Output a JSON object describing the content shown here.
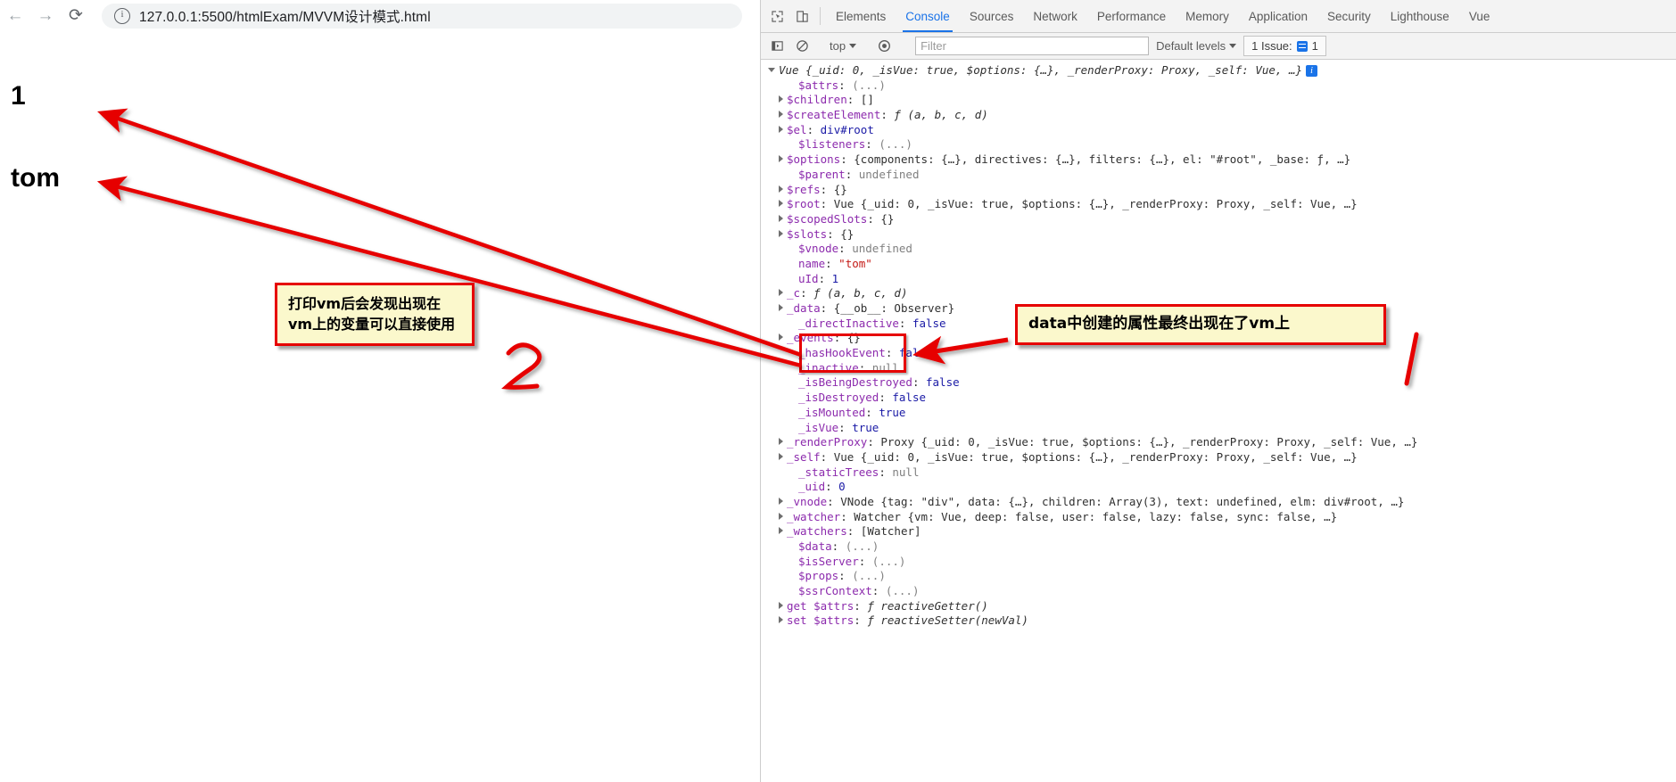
{
  "browser": {
    "back_icon": "arrow-left-icon",
    "forward_icon": "arrow-right-icon",
    "reload_icon": "reload-icon",
    "site_info_icon": "info-circle-icon",
    "url": "127.0.0.1:5500/htmlExam/MVVM设计模式.html"
  },
  "page": {
    "uid_text": "1",
    "name_text": "tom"
  },
  "annotations": {
    "left_box": "打印vm后会发现出现在vm上的变量可以直接使用",
    "right_box": "data中创建的属性最终出现在了vm上",
    "mark_two": "2",
    "mark_one": "1",
    "highlight_color": "#e60000",
    "box_fill": "#fbf8cc"
  },
  "devtools": {
    "inspect_icon": "inspect-element-icon",
    "device_icon": "device-toolbar-icon",
    "tabs": [
      {
        "label": "Elements",
        "selected": false
      },
      {
        "label": "Console",
        "selected": true
      },
      {
        "label": "Sources",
        "selected": false
      },
      {
        "label": "Network",
        "selected": false
      },
      {
        "label": "Performance",
        "selected": false
      },
      {
        "label": "Memory",
        "selected": false
      },
      {
        "label": "Application",
        "selected": false
      },
      {
        "label": "Security",
        "selected": false
      },
      {
        "label": "Lighthouse",
        "selected": false
      },
      {
        "label": "Vue",
        "selected": false
      }
    ],
    "toolbar": {
      "sidebar_icon": "console-sidebar-icon",
      "clear_icon": "clear-console-icon",
      "context": "top",
      "eye_icon": "live-expression-icon",
      "filter_value": "",
      "filter_placeholder": "Filter",
      "levels": "Default levels",
      "issues_label": "1 Issue:",
      "issues_icon": "issues-icon",
      "issues_count": "1",
      "accent_color": "#1a73e8"
    }
  },
  "console": {
    "header": {
      "type": "Vue",
      "text": "Vue {_uid: 0, _isVue: true, $options: {…}, _renderProxy: Proxy, _self: Vue, …}",
      "info_badge": "i"
    },
    "rows": [
      {
        "tri": "none",
        "key": "$attrs",
        "keyclass": "k-prop",
        "sep": ": ",
        "value": "(...)",
        "valclass": "v-dots"
      },
      {
        "tri": "closed",
        "key": "$children",
        "keyclass": "k-prop",
        "sep": ": ",
        "value": "[]",
        "valclass": "v-obj"
      },
      {
        "tri": "closed",
        "key": "$createElement",
        "keyclass": "k-prop",
        "sep": ": ",
        "value": "ƒ (a, b, c, d)",
        "valclass": "v-fn"
      },
      {
        "tri": "closed",
        "key": "$el",
        "keyclass": "k-prop",
        "sep": ": ",
        "value": "div#root",
        "valclass": "v-dom"
      },
      {
        "tri": "none",
        "key": "$listeners",
        "keyclass": "k-prop",
        "sep": ": ",
        "value": "(...)",
        "valclass": "v-dots"
      },
      {
        "tri": "closed",
        "key": "$options",
        "keyclass": "k-prop",
        "sep": ": ",
        "value": "{components: {…}, directives: {…}, filters: {…}, el: \"#root\", _base: ƒ, …}",
        "valclass": "v-obj"
      },
      {
        "tri": "none",
        "key": "$parent",
        "keyclass": "k-prop",
        "sep": ": ",
        "value": "undefined",
        "valclass": "v-undef"
      },
      {
        "tri": "closed",
        "key": "$refs",
        "keyclass": "k-prop",
        "sep": ": ",
        "value": "{}",
        "valclass": "v-obj"
      },
      {
        "tri": "closed",
        "key": "$root",
        "keyclass": "k-prop",
        "sep": ": ",
        "value": "Vue {_uid: 0, _isVue: true, $options: {…}, _renderProxy: Proxy, _self: Vue, …}",
        "valclass": "v-obj"
      },
      {
        "tri": "closed",
        "key": "$scopedSlots",
        "keyclass": "k-prop",
        "sep": ": ",
        "value": "{}",
        "valclass": "v-obj"
      },
      {
        "tri": "closed",
        "key": "$slots",
        "keyclass": "k-prop",
        "sep": ": ",
        "value": "{}",
        "valclass": "v-obj"
      },
      {
        "tri": "none",
        "key": "$vnode",
        "keyclass": "k-prop",
        "sep": ": ",
        "value": "undefined",
        "valclass": "v-undef"
      },
      {
        "tri": "none",
        "key": "name",
        "keyclass": "k-prop",
        "sep": ": ",
        "value": "\"tom\"",
        "valclass": "v-str"
      },
      {
        "tri": "none",
        "key": "uId",
        "keyclass": "k-prop",
        "sep": ": ",
        "value": "1",
        "valclass": "v-num"
      },
      {
        "tri": "closed",
        "key": "_c",
        "keyclass": "k-prop",
        "sep": ": ",
        "value": "ƒ (a, b, c, d)",
        "valclass": "v-fn"
      },
      {
        "tri": "closed",
        "key": "_data",
        "keyclass": "k-prop",
        "sep": ": ",
        "value": "{__ob__: Observer}",
        "valclass": "v-obj"
      },
      {
        "tri": "none",
        "key": "_directInactive",
        "keyclass": "k-prop",
        "sep": ": ",
        "value": "false",
        "valclass": "v-bool"
      },
      {
        "tri": "closed",
        "key": "_events",
        "keyclass": "k-prop",
        "sep": ": ",
        "value": "{}",
        "valclass": "v-obj"
      },
      {
        "tri": "none",
        "key": "_hasHookEvent",
        "keyclass": "k-prop",
        "sep": ": ",
        "value": "false",
        "valclass": "v-bool"
      },
      {
        "tri": "none",
        "key": "_inactive",
        "keyclass": "k-prop",
        "sep": ": ",
        "value": "null",
        "valclass": "v-null"
      },
      {
        "tri": "none",
        "key": "_isBeingDestroyed",
        "keyclass": "k-prop",
        "sep": ": ",
        "value": "false",
        "valclass": "v-bool"
      },
      {
        "tri": "none",
        "key": "_isDestroyed",
        "keyclass": "k-prop",
        "sep": ": ",
        "value": "false",
        "valclass": "v-bool"
      },
      {
        "tri": "none",
        "key": "_isMounted",
        "keyclass": "k-prop",
        "sep": ": ",
        "value": "true",
        "valclass": "v-bool"
      },
      {
        "tri": "none",
        "key": "_isVue",
        "keyclass": "k-prop",
        "sep": ": ",
        "value": "true",
        "valclass": "v-bool"
      },
      {
        "tri": "closed",
        "key": "_renderProxy",
        "keyclass": "k-prop",
        "sep": ": ",
        "value": "Proxy {_uid: 0, _isVue: true, $options: {…}, _renderProxy: Proxy, _self: Vue, …}",
        "valclass": "v-obj"
      },
      {
        "tri": "closed",
        "key": "_self",
        "keyclass": "k-prop",
        "sep": ": ",
        "value": "Vue {_uid: 0, _isVue: true, $options: {…}, _renderProxy: Proxy, _self: Vue, …}",
        "valclass": "v-obj"
      },
      {
        "tri": "none",
        "key": "_staticTrees",
        "keyclass": "k-prop",
        "sep": ": ",
        "value": "null",
        "valclass": "v-null"
      },
      {
        "tri": "none",
        "key": "_uid",
        "keyclass": "k-prop",
        "sep": ": ",
        "value": "0",
        "valclass": "v-num"
      },
      {
        "tri": "closed",
        "key": "_vnode",
        "keyclass": "k-prop",
        "sep": ": ",
        "value": "VNode {tag: \"div\", data: {…}, children: Array(3), text: undefined, elm: div#root, …}",
        "valclass": "v-obj"
      },
      {
        "tri": "closed",
        "key": "_watcher",
        "keyclass": "k-prop",
        "sep": ": ",
        "value": "Watcher {vm: Vue, deep: false, user: false, lazy: false, sync: false, …}",
        "valclass": "v-obj"
      },
      {
        "tri": "closed",
        "key": "_watchers",
        "keyclass": "k-prop",
        "sep": ": ",
        "value": "[Watcher]",
        "valclass": "v-obj"
      },
      {
        "tri": "none",
        "key": "$data",
        "keyclass": "k-prop",
        "sep": ": ",
        "value": "(...)",
        "valclass": "v-dots"
      },
      {
        "tri": "none",
        "key": "$isServer",
        "keyclass": "k-prop",
        "sep": ": ",
        "value": "(...)",
        "valclass": "v-dots"
      },
      {
        "tri": "none",
        "key": "$props",
        "keyclass": "k-prop",
        "sep": ": ",
        "value": "(...)",
        "valclass": "v-dots"
      },
      {
        "tri": "none",
        "key": "$ssrContext",
        "keyclass": "k-prop",
        "sep": ": ",
        "value": "(...)",
        "valclass": "v-dots"
      },
      {
        "tri": "closed",
        "key": "get $attrs",
        "keyclass": "k-prop",
        "sep": ": ",
        "value": "ƒ reactiveGetter()",
        "valclass": "v-fn"
      },
      {
        "tri": "closed",
        "key": "set $attrs",
        "keyclass": "k-prop",
        "sep": ": ",
        "value": "ƒ reactiveSetter(newVal)",
        "valclass": "v-fn"
      }
    ]
  }
}
